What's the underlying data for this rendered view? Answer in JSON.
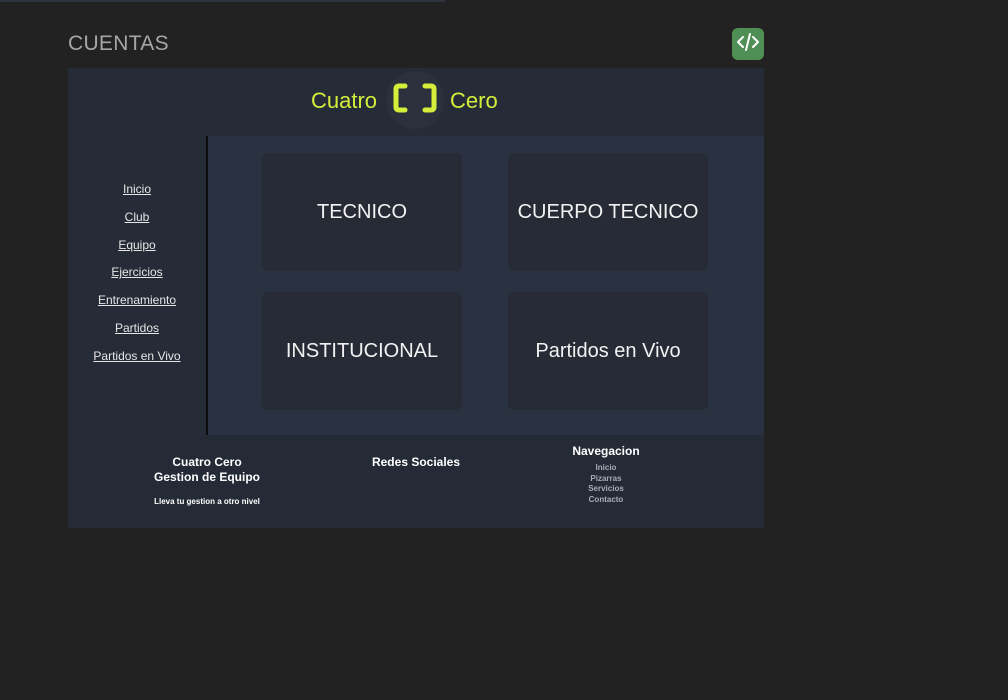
{
  "page": {
    "title": "CUENTAS",
    "code_icon": "code-icon"
  },
  "header": {
    "brand_left": "Cuatro",
    "brand_right": "Cero",
    "logo_icon": "brackets-logo-icon",
    "accent_color": "#d4ee3a"
  },
  "sidebar": {
    "items": [
      {
        "label": "Inicio"
      },
      {
        "label": "Club"
      },
      {
        "label": "Equipo"
      },
      {
        "label": "Ejercicios"
      },
      {
        "label": "Entrenamiento"
      },
      {
        "label": "Partidos"
      },
      {
        "label": "Partidos en Vivo"
      }
    ]
  },
  "cards": [
    {
      "label": "TECNICO"
    },
    {
      "label": "CUERPO TECNICO"
    },
    {
      "label": "INSTITUCIONAL"
    },
    {
      "label": "Partidos en Vivo"
    }
  ],
  "footer": {
    "brand_line1": "Cuatro Cero",
    "brand_line2": "Gestion de Equipo",
    "tagline": "Lleva tu gestion a otro nivel",
    "social_title": "Redes Sociales",
    "nav_title": "Navegacion",
    "nav_links": [
      {
        "label": "Inicio"
      },
      {
        "label": "Pizarras"
      },
      {
        "label": "Servicios"
      },
      {
        "label": "Contacto"
      }
    ]
  },
  "colors": {
    "background": "#222222",
    "frame": "#252b36",
    "main_panel": "#2a3242",
    "card": "#262b36",
    "code_button": "#4f8f55"
  }
}
